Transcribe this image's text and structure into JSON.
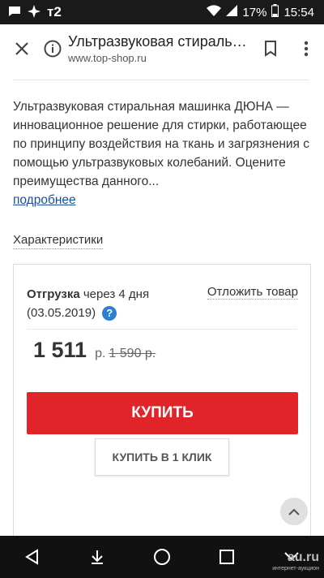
{
  "status_bar": {
    "carrier": "т2",
    "battery": "17%",
    "time": "15:54"
  },
  "app_bar": {
    "title": "Ультразвуковая стиральная машинка ДЮНА",
    "url": "www.top-shop.ru"
  },
  "product": {
    "description": "Ультразвуковая стиральная машинка ДЮНА — инновационное решение для стирки, работающее по принципу воздействия на ткань и загрязнения с помощью ультразвуковых колебаний. Оцените преимущества данного...",
    "more_link": "подробнее",
    "characteristics_tab": "Характеристики"
  },
  "purchase": {
    "shipping_label": "Отгрузка",
    "shipping_text": "через 4 дня",
    "shipping_date": "(03.05.2019)",
    "help_symbol": "?",
    "defer_label": "Отложить товар",
    "price": "1 511",
    "currency": "р.",
    "old_price": "1 590 р.",
    "buy_label": "КУПИТЬ",
    "one_click_label": "КУПИТЬ В 1 КЛИК"
  },
  "watermark": {
    "brand": "au.ru",
    "tagline": "интернет-аукцион"
  },
  "colors": {
    "accent_red": "#e1242a",
    "link_blue": "#1a4f9c",
    "help_blue": "#2f7fd1"
  }
}
